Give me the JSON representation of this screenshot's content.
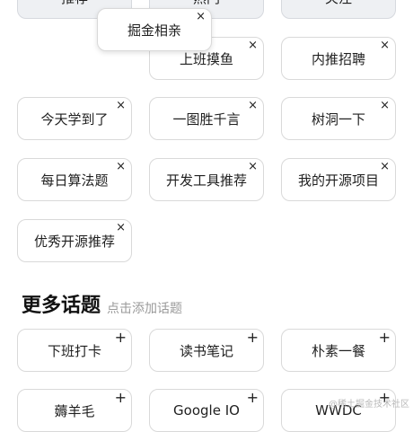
{
  "my_topics": {
    "top_partial": [
      "推荐",
      "热门",
      "关注"
    ],
    "dragging": "掘金相亲",
    "items": [
      "上班摸鱼",
      "内推招聘",
      "今天学到了",
      "一图胜千言",
      "树洞一下",
      "每日算法题",
      "开发工具推荐",
      "我的开源项目",
      "优秀开源推荐"
    ],
    "remove_symbol": "×"
  },
  "more_topics": {
    "title": "更多话题",
    "hint": "点击添加话题",
    "items": [
      "下班打卡",
      "读书笔记",
      "朴素一餐",
      "薅羊毛",
      "Google IO",
      "WWDC"
    ],
    "add_symbol": "+"
  },
  "watermark": "@稀土掘金技术社区"
}
